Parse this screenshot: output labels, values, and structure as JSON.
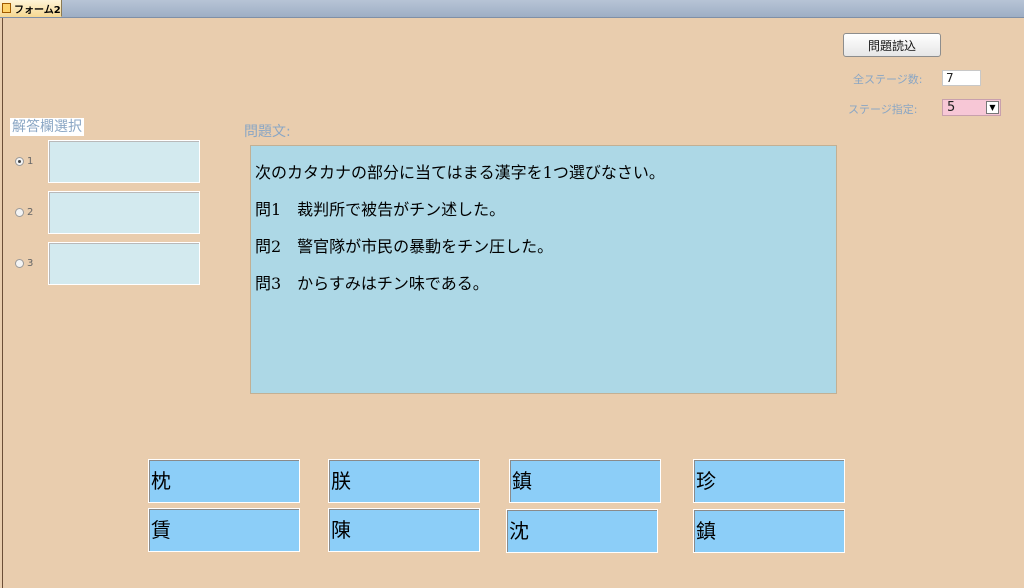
{
  "tab": {
    "label": "フォーム2"
  },
  "toolbar": {
    "load_button": "問題読込"
  },
  "settings": {
    "total_stages_label": "全ステージ数:",
    "total_stages_value": "7",
    "stage_select_label": "ステージ指定:",
    "stage_select_value": "5",
    "dropdown_arrow": "▼"
  },
  "answers": {
    "label": "解答欄選択",
    "rows": [
      {
        "number": "1",
        "selected": true,
        "value": ""
      },
      {
        "number": "2",
        "selected": false,
        "value": ""
      },
      {
        "number": "3",
        "selected": false,
        "value": ""
      }
    ]
  },
  "question": {
    "label": "問題文:",
    "lines": [
      "次のカタカナの部分に当てはまる漢字を1つ選びなさい。",
      "問1　裁判所で被告がチン述した。",
      "問2　警官隊が市民の暴動をチン圧した。",
      "問3　からすみはチン味である。"
    ]
  },
  "choices": {
    "row1": [
      "枕",
      "朕",
      "鎮",
      "珍"
    ],
    "row2": [
      "賃",
      "陳",
      "沈",
      "鎮"
    ]
  }
}
